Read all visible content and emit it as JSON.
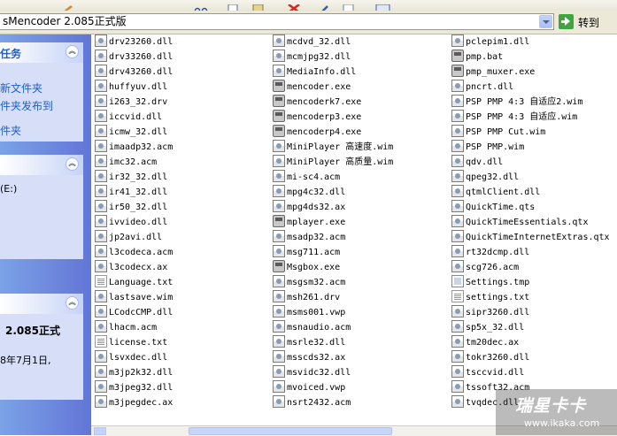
{
  "address": {
    "path": "sMencoder 2.085正式版",
    "go_label": "转到"
  },
  "left_pane": {
    "tasks_title": "任务",
    "task_links": [
      "新文件夹",
      "件夹发布到",
      "件夹"
    ],
    "places_item": "(E:)",
    "details_name": "2.085正式",
    "details_date": "8年7月1日,"
  },
  "files": {
    "col1": [
      {
        "name": "drv23260.dll",
        "icon": "dll-icon"
      },
      {
        "name": "drv33260.dll",
        "icon": "dll-icon"
      },
      {
        "name": "drv43260.dll",
        "icon": "dll-icon"
      },
      {
        "name": "huffyuv.dll",
        "icon": "dll-icon"
      },
      {
        "name": "i263_32.drv",
        "icon": "dll-icon"
      },
      {
        "name": "iccvid.dll",
        "icon": "dll-icon"
      },
      {
        "name": "icmw_32.dll",
        "icon": "dll-icon"
      },
      {
        "name": "imaadp32.acm",
        "icon": "dll-icon"
      },
      {
        "name": "imc32.acm",
        "icon": "dll-icon"
      },
      {
        "name": "ir32_32.dll",
        "icon": "dll-icon"
      },
      {
        "name": "ir41_32.dll",
        "icon": "dll-icon"
      },
      {
        "name": "ir50_32.dll",
        "icon": "dll-icon"
      },
      {
        "name": "ivvideo.dll",
        "icon": "dll-icon"
      },
      {
        "name": "jp2avi.dll",
        "icon": "dll-icon"
      },
      {
        "name": "l3codeca.acm",
        "icon": "dll-icon"
      },
      {
        "name": "l3codecx.ax",
        "icon": "dll-icon"
      },
      {
        "name": "Language.txt",
        "icon": "text-file-icon"
      },
      {
        "name": "lastsave.wim",
        "icon": "dll-icon"
      },
      {
        "name": "LCodcCMP.dll",
        "icon": "dll-icon"
      },
      {
        "name": "lhacm.acm",
        "icon": "dll-icon"
      },
      {
        "name": "license.txt",
        "icon": "text-file-icon"
      },
      {
        "name": "lsvxdec.dll",
        "icon": "dll-icon"
      },
      {
        "name": "m3jp2k32.dll",
        "icon": "dll-icon"
      },
      {
        "name": "m3jpeg32.dll",
        "icon": "dll-icon"
      },
      {
        "name": "m3jpegdec.ax",
        "icon": "dll-icon"
      }
    ],
    "col2": [
      {
        "name": "mcdvd_32.dll",
        "icon": "dll-icon"
      },
      {
        "name": "mcmjpg32.dll",
        "icon": "dll-icon"
      },
      {
        "name": "MediaInfo.dll",
        "icon": "dll-icon"
      },
      {
        "name": "mencoder.exe",
        "icon": "exe-icon"
      },
      {
        "name": "mencoderk7.exe",
        "icon": "exe-icon"
      },
      {
        "name": "mencoderp3.exe",
        "icon": "exe-icon"
      },
      {
        "name": "mencoderp4.exe",
        "icon": "exe-icon"
      },
      {
        "name": "MiniPlayer 高速度.wim",
        "icon": "dll-icon"
      },
      {
        "name": "MiniPlayer 高质量.wim",
        "icon": "dll-icon"
      },
      {
        "name": "mi-sc4.acm",
        "icon": "dll-icon"
      },
      {
        "name": "mpg4c32.dll",
        "icon": "dll-icon"
      },
      {
        "name": "mpg4ds32.ax",
        "icon": "dll-icon"
      },
      {
        "name": "mplayer.exe",
        "icon": "exe-icon"
      },
      {
        "name": "msadp32.acm",
        "icon": "dll-icon"
      },
      {
        "name": "msg711.acm",
        "icon": "dll-icon"
      },
      {
        "name": "Msgbox.exe",
        "icon": "exe-icon"
      },
      {
        "name": "msgsm32.acm",
        "icon": "dll-icon"
      },
      {
        "name": "msh261.drv",
        "icon": "dll-icon"
      },
      {
        "name": "msms001.vwp",
        "icon": "dll-icon"
      },
      {
        "name": "msnaudio.acm",
        "icon": "dll-icon"
      },
      {
        "name": "msrle32.dll",
        "icon": "dll-icon"
      },
      {
        "name": "msscds32.ax",
        "icon": "dll-icon"
      },
      {
        "name": "msvidc32.dll",
        "icon": "dll-icon"
      },
      {
        "name": "mvoiced.vwp",
        "icon": "dll-icon"
      },
      {
        "name": "nsrt2432.acm",
        "icon": "dll-icon"
      }
    ],
    "col3": [
      {
        "name": "pclepim1.dll",
        "icon": "dll-icon"
      },
      {
        "name": "pmp.bat",
        "icon": "exe-icon"
      },
      {
        "name": "pmp_muxer.exe",
        "icon": "exe-icon"
      },
      {
        "name": "pncrt.dll",
        "icon": "dll-icon"
      },
      {
        "name": "PSP PMP 4:3 自适应2.wim",
        "icon": "dll-icon"
      },
      {
        "name": "PSP PMP 4:3 自适应.wim",
        "icon": "dll-icon"
      },
      {
        "name": "PSP PMP Cut.wim",
        "icon": "dll-icon"
      },
      {
        "name": "PSP PMP.wim",
        "icon": "dll-icon"
      },
      {
        "name": "qdv.dll",
        "icon": "dll-icon"
      },
      {
        "name": "qpeg32.dll",
        "icon": "dll-icon"
      },
      {
        "name": "qtmlClient.dll",
        "icon": "dll-icon"
      },
      {
        "name": "QuickTime.qts",
        "icon": "dll-icon"
      },
      {
        "name": "QuickTimeEssentials.qtx",
        "icon": "dll-icon"
      },
      {
        "name": "QuickTimeInternetExtras.qtx",
        "icon": "dll-icon"
      },
      {
        "name": "rt32dcmp.dll",
        "icon": "dll-icon"
      },
      {
        "name": "scg726.acm",
        "icon": "dll-icon"
      },
      {
        "name": "Settings.tmp",
        "icon": "file-icon"
      },
      {
        "name": "settings.txt",
        "icon": "text-file-icon"
      },
      {
        "name": "sipr3260.dll",
        "icon": "dll-icon"
      },
      {
        "name": "sp5x_32.dll",
        "icon": "dll-icon"
      },
      {
        "name": "tm20dec.ax",
        "icon": "dll-icon"
      },
      {
        "name": "tokr3260.dll",
        "icon": "dll-icon"
      },
      {
        "name": "tsccvid.dll",
        "icon": "dll-icon"
      },
      {
        "name": "tssoft32.acm",
        "icon": "dll-icon"
      },
      {
        "name": "tvqdec.dll",
        "icon": "dll-icon"
      }
    ]
  },
  "watermark": {
    "main": "瑞星卡卡",
    "sub": "www.ikaka.com"
  },
  "colors": {
    "task_link": "#215dc6",
    "left_pane_bg": "#6f8fdf",
    "go_green": "#3ea43e"
  }
}
